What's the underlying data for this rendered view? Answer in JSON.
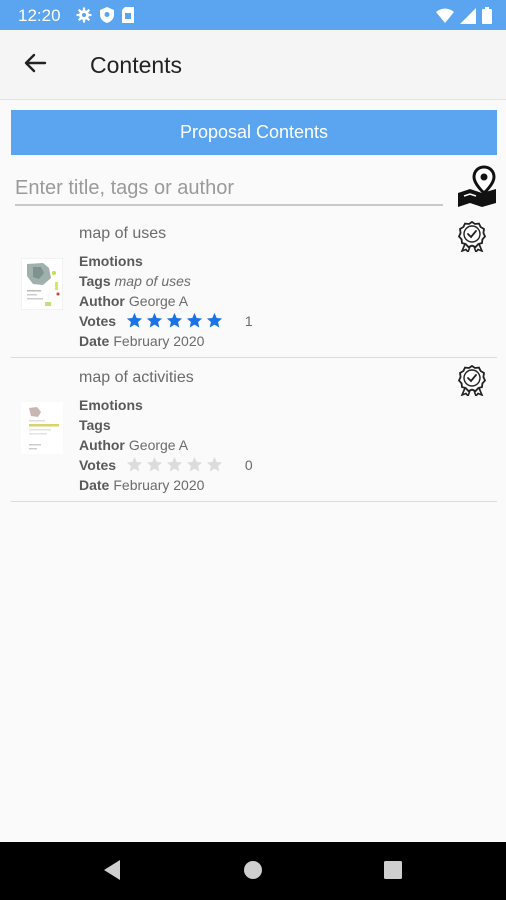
{
  "status_bar": {
    "time": "12:20"
  },
  "app_bar": {
    "title": "Contents"
  },
  "banner": {
    "label": "Proposal Contents"
  },
  "search": {
    "placeholder": "Enter title, tags or author",
    "value": ""
  },
  "colors": {
    "accent": "#5aa4f0",
    "star_on": "#1a73e8",
    "star_off": "#dcdcdc"
  },
  "labels": {
    "emotions": "Emotions",
    "tags": "Tags",
    "author": "Author",
    "votes": "Votes",
    "date": "Date"
  },
  "items": [
    {
      "title": "map of uses",
      "tags": "map of uses",
      "author": "George A",
      "stars": 5,
      "votes": "1",
      "date": "February 2020",
      "icon": "award-check-icon"
    },
    {
      "title": "map of activities",
      "tags": "",
      "author": "George A",
      "stars": 0,
      "votes": "0",
      "date": "February 2020",
      "icon": "award-check-icon"
    }
  ]
}
